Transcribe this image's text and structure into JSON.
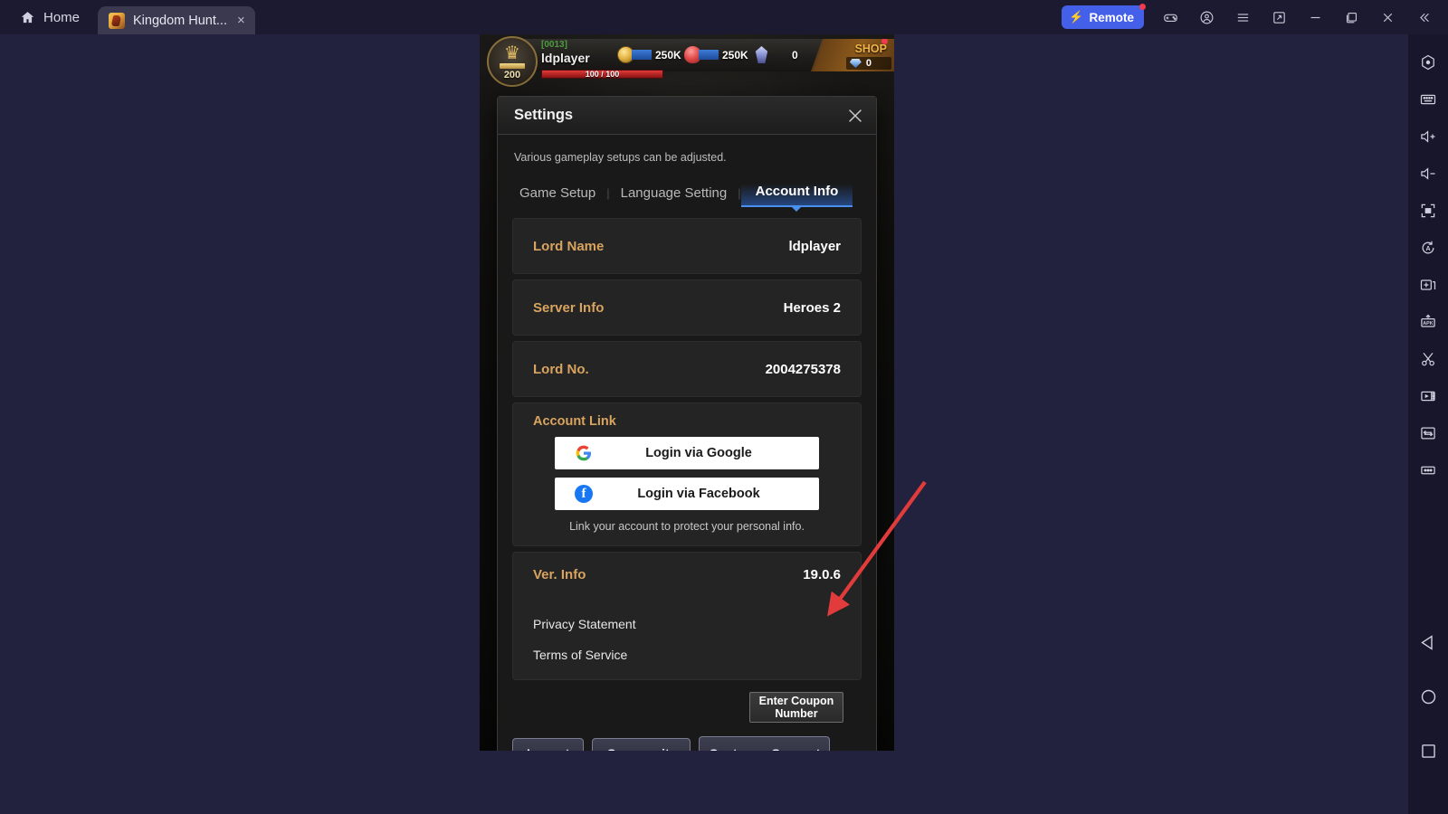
{
  "topbar": {
    "home_label": "Home",
    "home_icon": "home-icon",
    "tab_title": "Kingdom Hunt...",
    "tab_close_glyph": "×",
    "remote_label": "Remote",
    "remote_bolt": "⚡",
    "icons": [
      {
        "name": "gamepad-icon"
      },
      {
        "name": "account-icon"
      },
      {
        "name": "menu-icon"
      },
      {
        "name": "screenshot-icon"
      },
      {
        "name": "minimize-icon"
      },
      {
        "name": "maximize-icon"
      },
      {
        "name": "close-icon"
      },
      {
        "name": "collapse-icon"
      }
    ]
  },
  "sidebar": {
    "items": [
      {
        "name": "settings-icon"
      },
      {
        "name": "keyboard-icon"
      },
      {
        "name": "volume-up-icon"
      },
      {
        "name": "volume-down-icon"
      },
      {
        "name": "fullscreen-icon"
      },
      {
        "name": "auto-rotate-icon"
      },
      {
        "name": "add-window-icon"
      },
      {
        "name": "install-apk-icon"
      },
      {
        "name": "scissors-icon"
      },
      {
        "name": "video-record-icon"
      },
      {
        "name": "file-transfer-icon"
      },
      {
        "name": "more-icon"
      }
    ],
    "nav": [
      {
        "name": "android-back-icon"
      },
      {
        "name": "android-home-icon"
      },
      {
        "name": "android-recents-icon"
      }
    ]
  },
  "game_hud": {
    "guild_tag": "[0013]",
    "player_name": "ldplayer",
    "level": "200",
    "hp": "100 / 100",
    "resources": [
      {
        "icon": "gold-icon",
        "value": "250K"
      },
      {
        "icon": "food-icon",
        "value": "250K"
      },
      {
        "icon": "crystal-icon",
        "value": "0"
      }
    ],
    "shop_label": "SHOP",
    "gem_value": "0"
  },
  "dialog": {
    "title": "Settings",
    "close_icon": "close-icon",
    "subtitle": "Various gameplay setups can be adjusted.",
    "tabs": [
      {
        "label": "Game Setup",
        "active": false
      },
      {
        "label": "Language Setting",
        "active": false
      },
      {
        "label": "Account Info",
        "active": true
      }
    ],
    "tab_separator": "|",
    "info_rows": [
      {
        "label": "Lord Name",
        "value": "ldplayer"
      },
      {
        "label": "Server Info",
        "value": "Heroes 2"
      },
      {
        "label": "Lord No.",
        "value": "2004275378"
      }
    ],
    "account_link": {
      "title": "Account Link",
      "google_label": "Login via Google",
      "google_icon": "google-icon",
      "facebook_label": "Login via Facebook",
      "facebook_icon": "facebook-icon",
      "note": "Link your account to protect your personal info."
    },
    "version": {
      "label": "Ver. Info",
      "value": "19.0.6"
    },
    "legal": [
      {
        "label": "Privacy Statement"
      },
      {
        "label": "Terms of Service"
      }
    ],
    "coupon_button": "Enter Coupon Number",
    "footer_buttons": [
      {
        "label": "Logout"
      },
      {
        "label": "Community"
      },
      {
        "label": "Customer Support"
      }
    ]
  },
  "annotation": {
    "arrow_color": "#e23b3b"
  }
}
